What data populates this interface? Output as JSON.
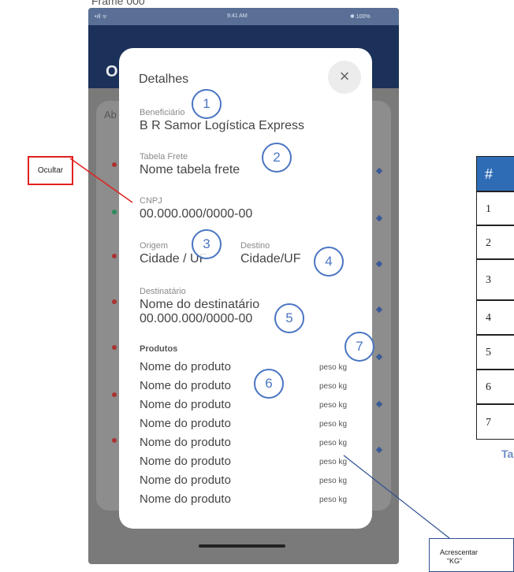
{
  "frame_label": "Frame 000",
  "status_bar": {
    "signal": "•ıll ᯤ",
    "time": "9:41 AM",
    "battery": "✱ 100%"
  },
  "app_title": "O",
  "bg_card_text": "Ab",
  "modal": {
    "title": "Detalhes",
    "close_icon": "×",
    "beneficiario": {
      "label": "Beneficiário",
      "value": "B R Samor Logística Express"
    },
    "tabela_frete": {
      "label": "Tabela Frete",
      "value": "Nome tabela frete"
    },
    "cnpj": {
      "label": "CNPJ",
      "value": "00.000.000/0000-00"
    },
    "origem": {
      "label": "Origem",
      "value": "Cidade / UF"
    },
    "destino": {
      "label": "Destino",
      "value": "Cidade/UF"
    },
    "destinatario": {
      "label": "Destinatário",
      "name": "Nome do destinatário",
      "doc": "00.000.000/0000-00"
    },
    "produtos_label": "Produtos",
    "produtos": [
      {
        "nome": "Nome do produto",
        "peso": "peso kg"
      },
      {
        "nome": "Nome do produto",
        "peso": "peso kg"
      },
      {
        "nome": "Nome do produto",
        "peso": "peso kg"
      },
      {
        "nome": "Nome do produto",
        "peso": "peso kg"
      },
      {
        "nome": "Nome do produto",
        "peso": "peso kg"
      },
      {
        "nome": "Nome do produto",
        "peso": "peso kg"
      },
      {
        "nome": "Nome do produto",
        "peso": "peso kg"
      },
      {
        "nome": "Nome do produto",
        "peso": "peso kg"
      }
    ]
  },
  "markers": [
    "1",
    "2",
    "3",
    "4",
    "5",
    "6",
    "7"
  ],
  "annotations": {
    "ocultar": "Ocultar",
    "acrescentar_line1": "Acrescentar",
    "acrescentar_line2": "“KG”"
  },
  "table": {
    "header": "#",
    "rows": [
      "1",
      "2",
      "3",
      "4",
      "5",
      "6",
      "7"
    ],
    "caption": "Ta"
  },
  "colors": {
    "accent": "#4a75c2",
    "annotation_red": "#e0221f",
    "table_header": "#2f6cb6",
    "app_bar": "#1c3159"
  }
}
